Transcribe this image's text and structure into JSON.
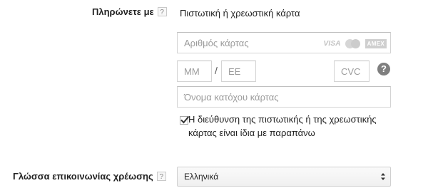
{
  "payment": {
    "label": "Πληρώνετε με",
    "help": "?",
    "method": "Πιστωτική ή χρεωστική κάρτα"
  },
  "card_number": {
    "placeholder": "Αριθμός κάρτας",
    "brands": [
      "VISA",
      "mastercard",
      "AMEX"
    ]
  },
  "expiry": {
    "month_placeholder": "MM",
    "separator": "/",
    "year_placeholder": "EE"
  },
  "cvc": {
    "placeholder": "CVC",
    "help": "?"
  },
  "cardholder": {
    "placeholder": "Όνομα κατόχου κάρτας"
  },
  "same_address": {
    "checked": true,
    "label": "Η διεύθυνση της πιστωτικής ή της χρεωστικής κάρτας είναι ίδια με παραπάνω"
  },
  "billing_language": {
    "label": "Γλώσσα επικοινωνίας χρέωσης",
    "help": "?",
    "selected": "Ελληνικά"
  },
  "icons": [
    "help-icon",
    "visa-logo-icon",
    "mastercard-logo-icon",
    "amex-logo-icon",
    "question-icon",
    "checkmark-icon",
    "select-arrows-icon"
  ]
}
